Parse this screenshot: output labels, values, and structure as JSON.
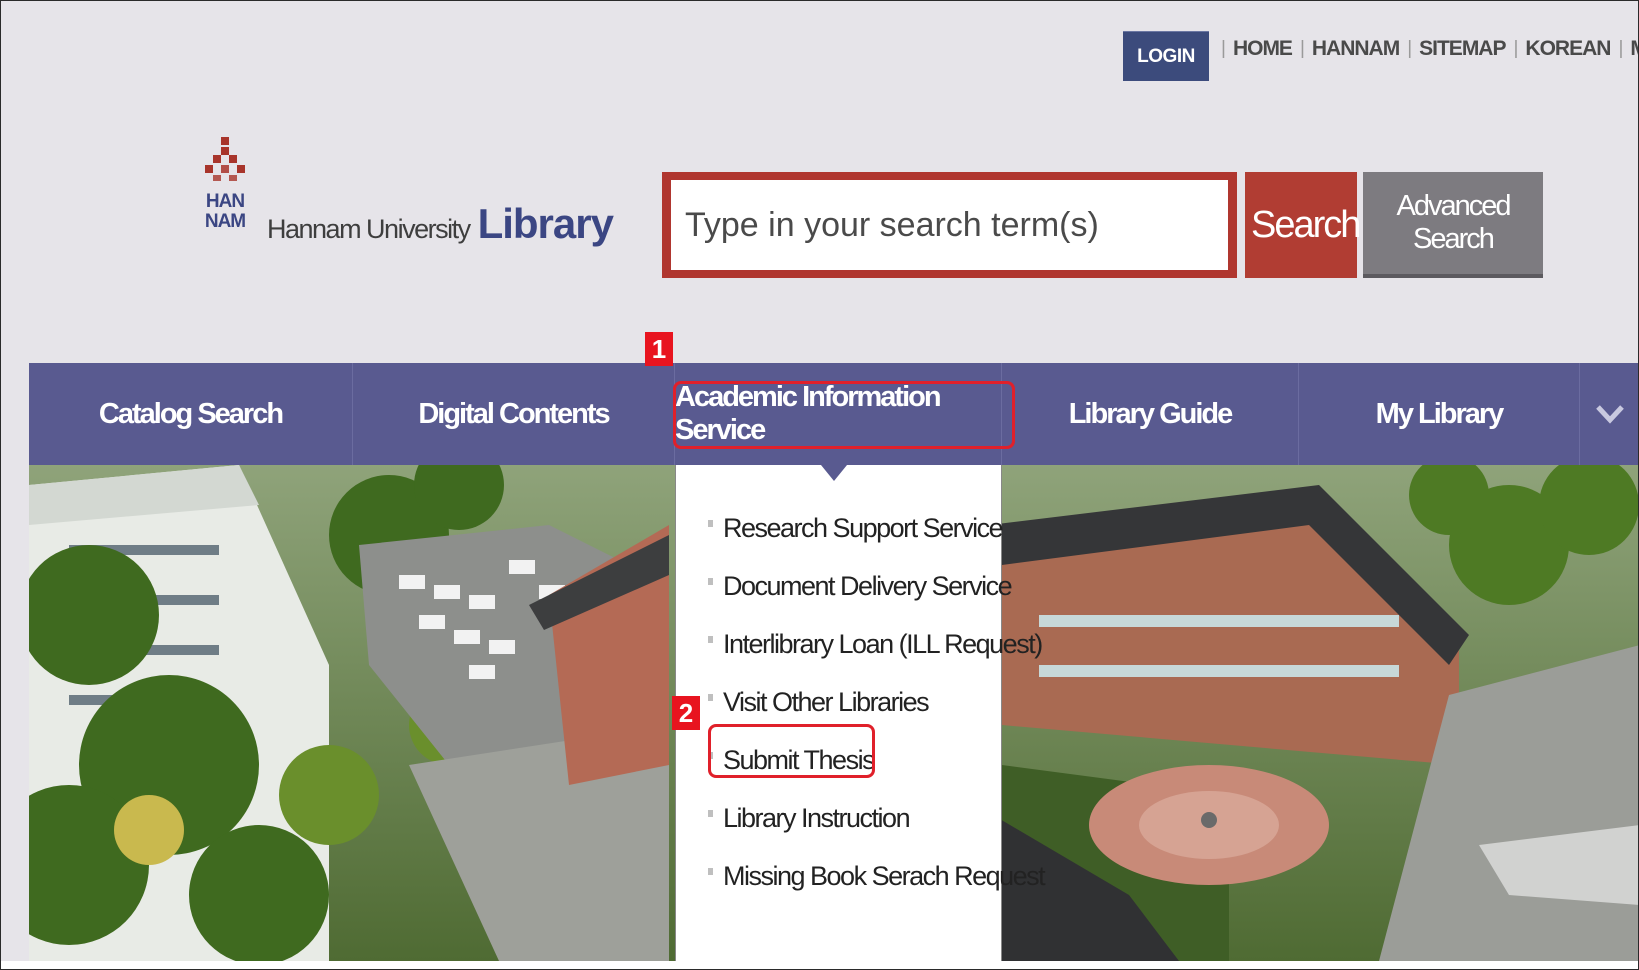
{
  "header": {
    "login_label": "LOGIN",
    "util_links": [
      "HOME",
      "HANNAM",
      "SITEMAP",
      "KOREAN",
      "My Porta"
    ]
  },
  "logo": {
    "mark_text": "HAN NAM",
    "university": "Hannam University",
    "library": "Library"
  },
  "search": {
    "placeholder": "Type in your search term(s)",
    "search_label": "Search",
    "advanced_label": "Advanced Search"
  },
  "nav": {
    "items": [
      "Catalog Search",
      "Digital Contents",
      "Academic Information Service",
      "Library Guide",
      "My Library"
    ],
    "more_icon": "chevron-down-icon"
  },
  "dropdown": {
    "items": [
      "Research Support Service",
      "Document Delivery Service",
      "Interlibrary Loan (ILL Request)",
      "Visit Other Libraries",
      "Submit Thesis",
      "Library Instruction",
      "Missing Book Serach Request"
    ]
  },
  "annotations": {
    "badge_1": "1",
    "badge_2": "2"
  },
  "colors": {
    "nav_bg": "#595a90",
    "search_red": "#b13d33",
    "login_bg": "#3c4b7c",
    "highlight": "#e0202a"
  }
}
